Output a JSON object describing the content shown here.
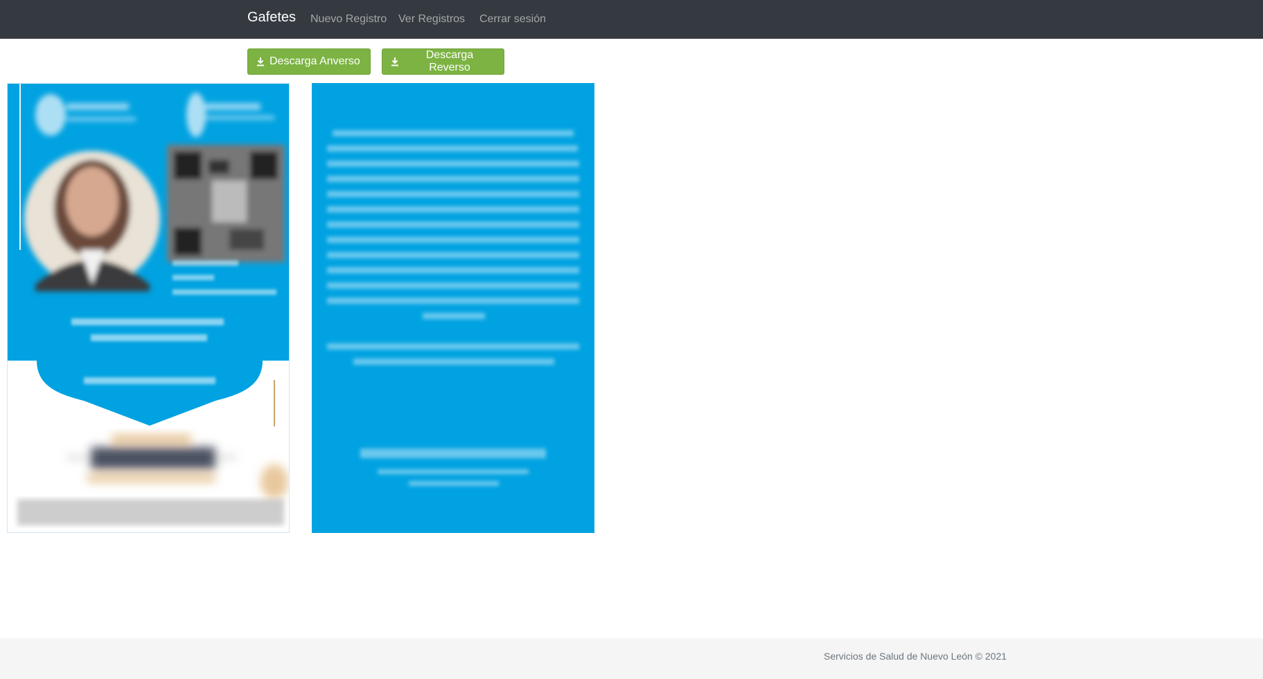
{
  "navbar": {
    "brand": "Gafetes",
    "links": [
      {
        "label": "Nuevo Registro"
      },
      {
        "label": "Ver Registros"
      },
      {
        "label": "Cerrar sesión"
      }
    ]
  },
  "toolbar": {
    "download_front_label": "Descarga Anverso",
    "download_back_label": "Descarga Reverso",
    "button_icon": "download-icon",
    "button_color": "#7cb342"
  },
  "badge": {
    "brand_color": "#01a2e1",
    "front_icon": "badge-front-image",
    "back_icon": "badge-back-image"
  },
  "footer": {
    "text": "Servicios de Salud de Nuevo León © 2021"
  },
  "colors": {
    "navbar_bg": "#343a40",
    "footer_bg": "#f5f5f5"
  }
}
